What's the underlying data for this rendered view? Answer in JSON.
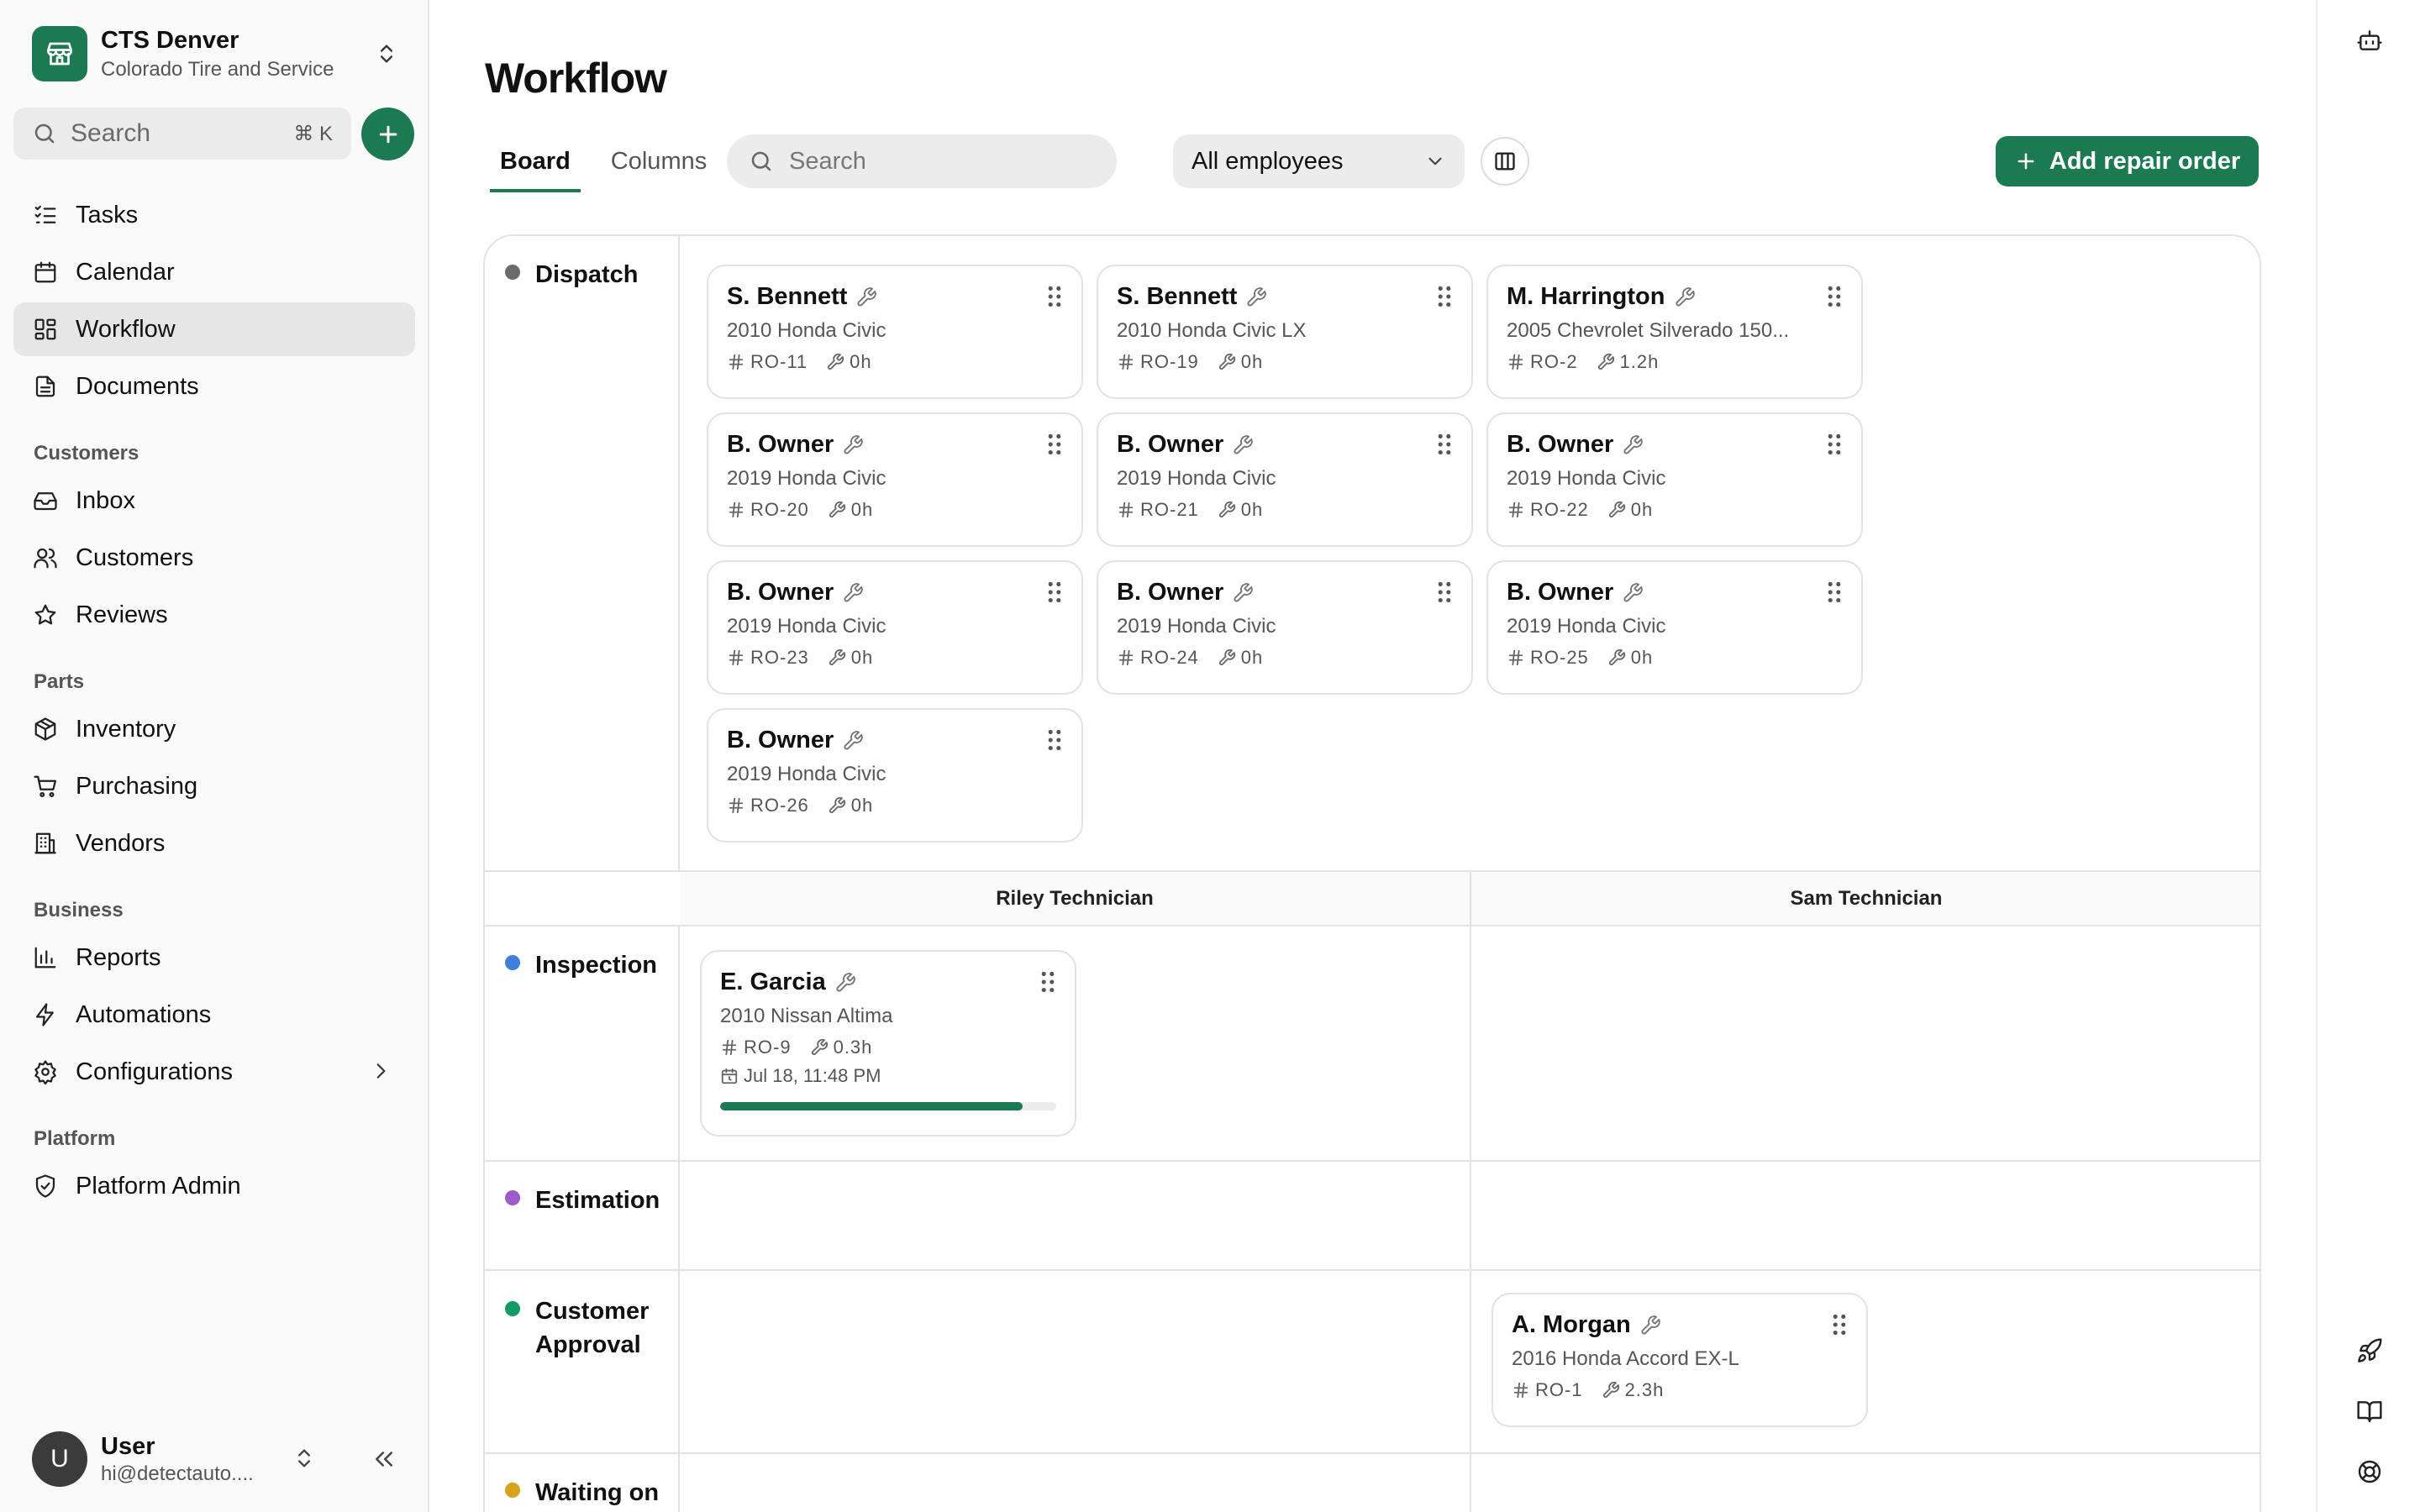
{
  "store": {
    "name": "CTS Denver",
    "subtitle": "Colorado Tire and Service"
  },
  "sidebar_search": {
    "placeholder": "Search",
    "shortcut": "⌘ K"
  },
  "nav": {
    "tasks": "Tasks",
    "calendar": "Calendar",
    "workflow": "Workflow",
    "documents": "Documents",
    "customers_section": "Customers",
    "inbox": "Inbox",
    "customers": "Customers",
    "reviews": "Reviews",
    "parts_section": "Parts",
    "inventory": "Inventory",
    "purchasing": "Purchasing",
    "vendors": "Vendors",
    "business_section": "Business",
    "reports": "Reports",
    "automations": "Automations",
    "configurations": "Configurations",
    "platform_section": "Platform",
    "platform_admin": "Platform Admin"
  },
  "user": {
    "initial": "U",
    "name": "User",
    "email": "hi@detectauto...."
  },
  "page": {
    "title": "Workflow"
  },
  "tabs": {
    "board": "Board",
    "columns": "Columns"
  },
  "toolbar": {
    "search_placeholder": "Search",
    "employee_filter": "All employees",
    "add_label": "Add repair order"
  },
  "colors": {
    "accent": "#1c7a52",
    "dispatch": "#6b6b6b",
    "inspection": "#3d7fd9",
    "estimation": "#9b5bc9",
    "approval": "#159a63",
    "waiting": "#d7a21c"
  },
  "stages": {
    "dispatch": "Dispatch",
    "inspection": "Inspection",
    "estimation": "Estimation",
    "approval_1": "Customer",
    "approval_2": "Approval",
    "waiting": "Waiting on"
  },
  "technicians": {
    "riley": "Riley Technician",
    "sam": "Sam Technician"
  },
  "dispatch_cards": [
    {
      "name": "S. Bennett",
      "vehicle": "2010 Honda Civic",
      "ro": "RO-11",
      "hours": "0h"
    },
    {
      "name": "S. Bennett",
      "vehicle": "2010 Honda Civic LX",
      "ro": "RO-19",
      "hours": "0h"
    },
    {
      "name": "M. Harrington",
      "vehicle": "2005 Chevrolet Silverado 150...",
      "ro": "RO-2",
      "hours": "1.2h"
    },
    {
      "name": "B. Owner",
      "vehicle": "2019 Honda Civic",
      "ro": "RO-20",
      "hours": "0h"
    },
    {
      "name": "B. Owner",
      "vehicle": "2019 Honda Civic",
      "ro": "RO-21",
      "hours": "0h"
    },
    {
      "name": "B. Owner",
      "vehicle": "2019 Honda Civic",
      "ro": "RO-22",
      "hours": "0h"
    },
    {
      "name": "B. Owner",
      "vehicle": "2019 Honda Civic",
      "ro": "RO-23",
      "hours": "0h"
    },
    {
      "name": "B. Owner",
      "vehicle": "2019 Honda Civic",
      "ro": "RO-24",
      "hours": "0h"
    },
    {
      "name": "B. Owner",
      "vehicle": "2019 Honda Civic",
      "ro": "RO-25",
      "hours": "0h"
    },
    {
      "name": "B. Owner",
      "vehicle": "2019 Honda Civic",
      "ro": "RO-26",
      "hours": "0h"
    }
  ],
  "inspection_card": {
    "name": "E. Garcia",
    "vehicle": "2010 Nissan Altima",
    "ro": "RO-9",
    "hours": "0.3h",
    "date": "Jul 18, 11:48 PM",
    "progress": 0.9
  },
  "approval_card": {
    "name": "A. Morgan",
    "vehicle": "2016 Honda Accord EX-L",
    "ro": "RO-1",
    "hours": "2.3h"
  }
}
